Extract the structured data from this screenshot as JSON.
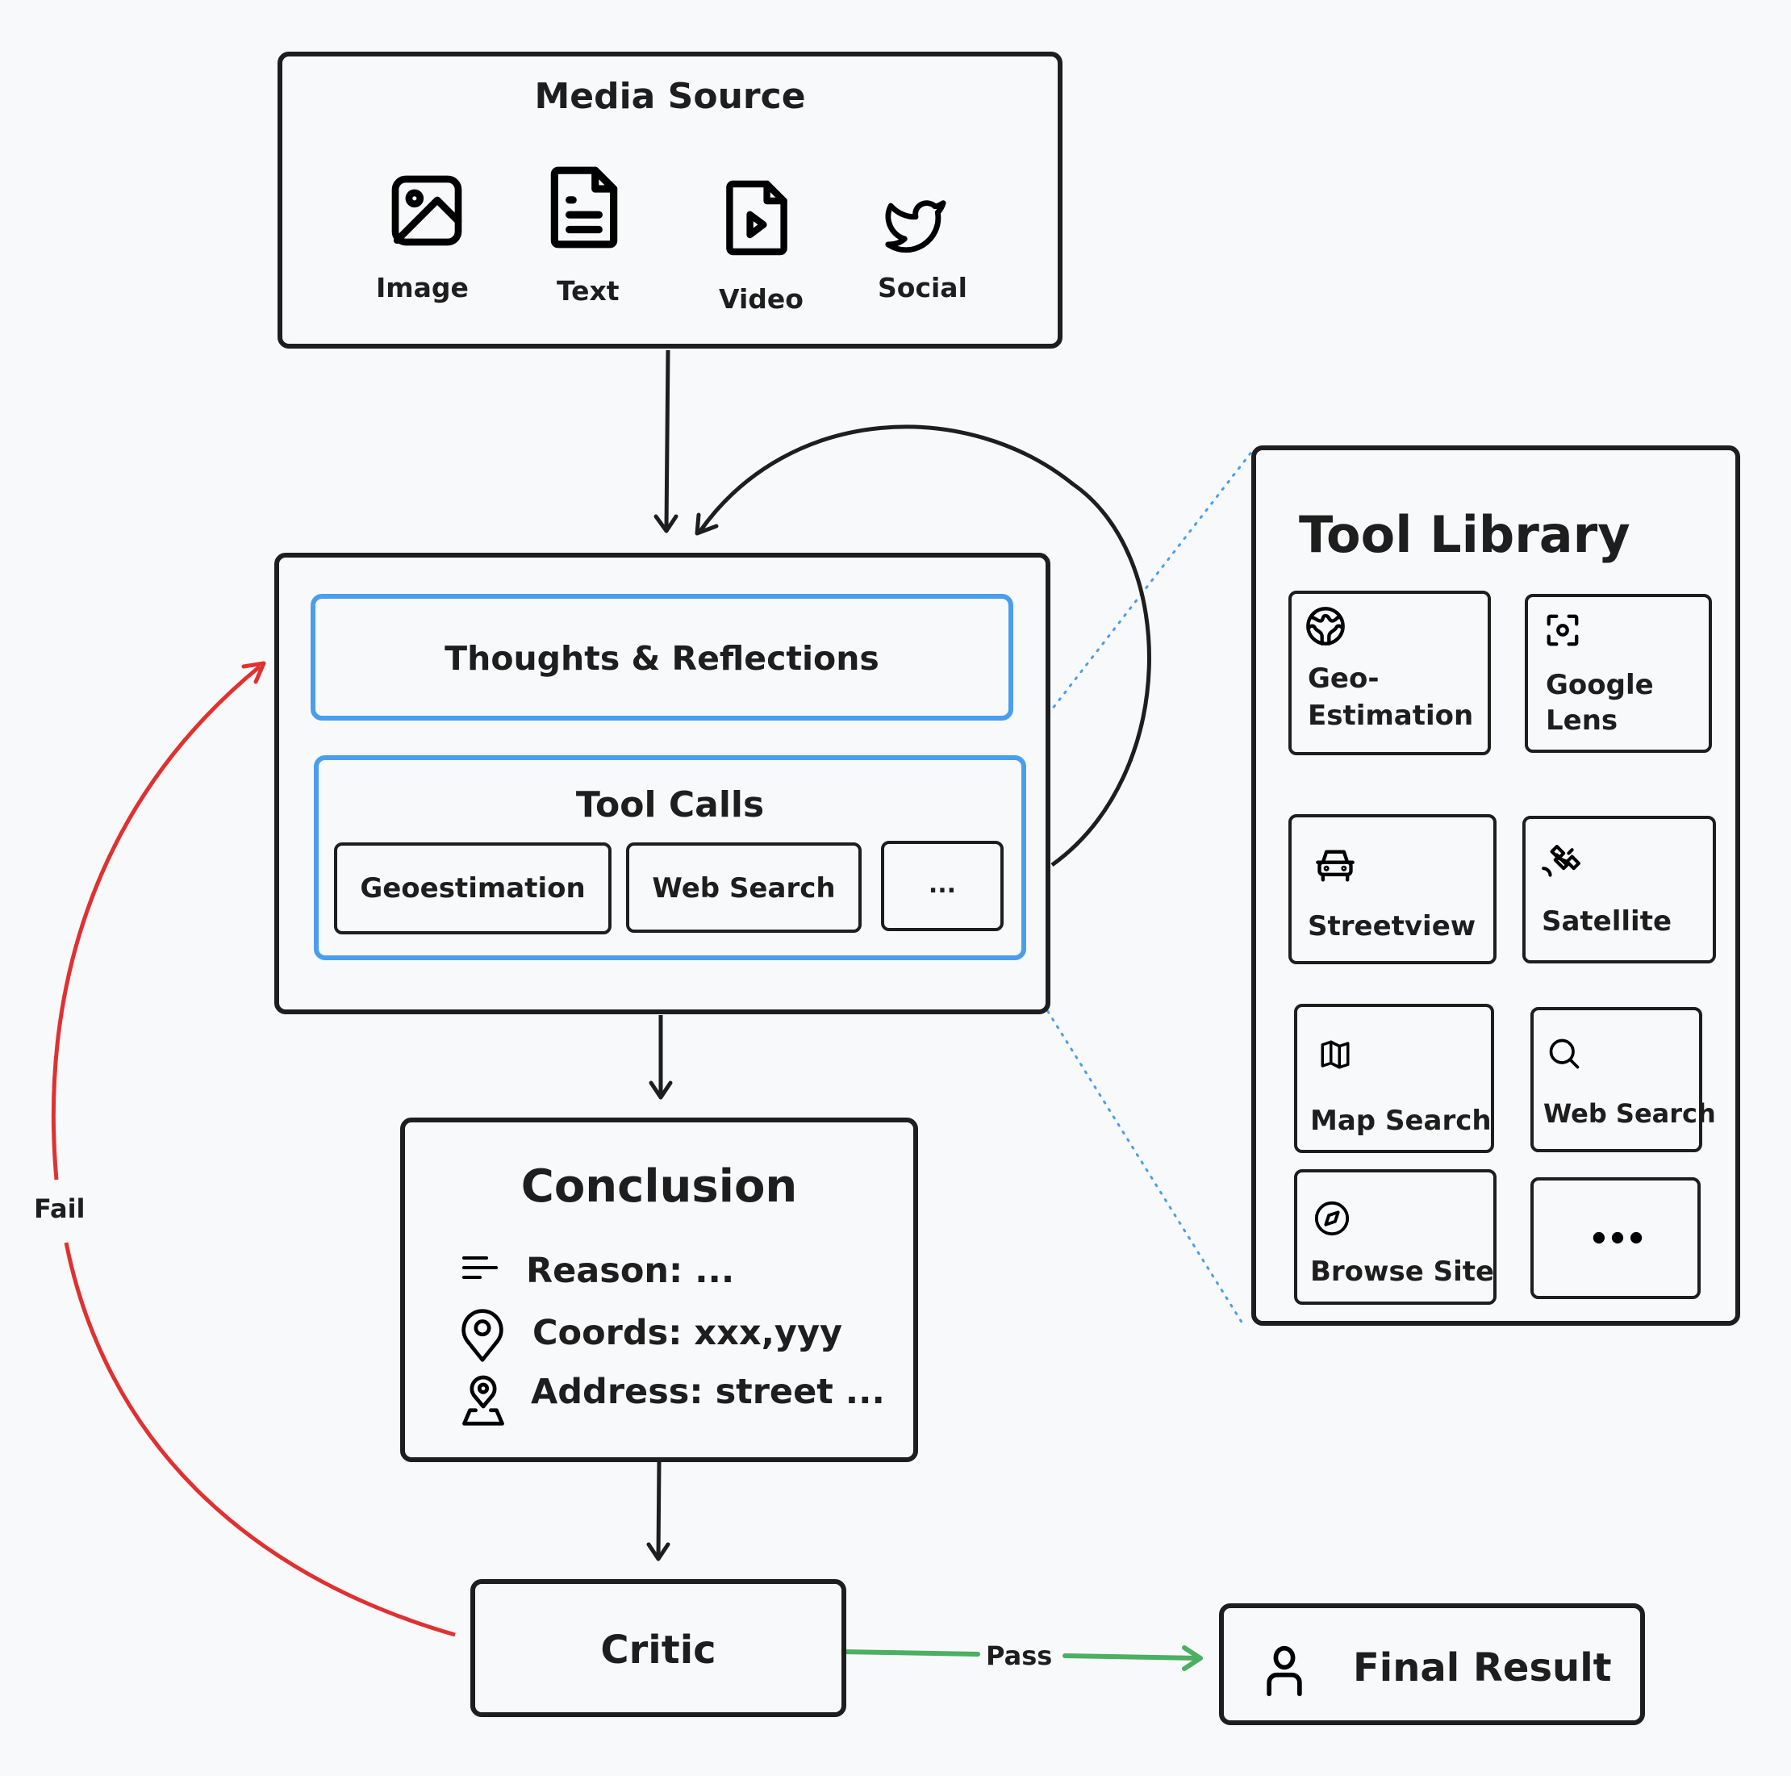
{
  "colors": {
    "background": "#f8f9fb",
    "stroke": "#1e1e1e",
    "accent_blue": "#4a9eed",
    "fail_red": "#e03131",
    "pass_green": "#4caf62"
  },
  "media_source": {
    "title": "Media Source",
    "items": [
      {
        "label": "Image",
        "icon": "image-icon"
      },
      {
        "label": "Text",
        "icon": "document-text-icon"
      },
      {
        "label": "Video",
        "icon": "video-file-icon"
      },
      {
        "label": "Social",
        "icon": "twitter-bird-icon"
      }
    ]
  },
  "agent": {
    "thoughts_label": "Thoughts & Reflections",
    "tool_calls": {
      "title": "Tool Calls",
      "items": [
        "Geoestimation",
        "Web Search",
        "..."
      ]
    }
  },
  "conclusion": {
    "title": "Conclusion",
    "rows": [
      {
        "icon": "text-lines-icon",
        "text": "Reason: ..."
      },
      {
        "icon": "map-pin-icon",
        "text": "Coords: xxx,yyy"
      },
      {
        "icon": "map-location-icon",
        "text": "Address: street ..."
      }
    ]
  },
  "critic": {
    "label": "Critic"
  },
  "edges": {
    "fail_label": "Fail",
    "pass_label": "Pass"
  },
  "final_result": {
    "label": "Final Result",
    "icon": "user-icon"
  },
  "tool_library": {
    "title": "Tool Library",
    "tools": [
      {
        "label_line1": "Geo-",
        "label_line2": "Estimation",
        "icon": "globe-icon"
      },
      {
        "label_line1": "Google",
        "label_line2": "Lens",
        "icon": "focus-scan-icon"
      },
      {
        "label_line1": "Streetview",
        "label_line2": "",
        "icon": "car-icon"
      },
      {
        "label_line1": "Satellite",
        "label_line2": "",
        "icon": "satellite-icon"
      },
      {
        "label_line1": "Map Search",
        "label_line2": "",
        "icon": "map-icon"
      },
      {
        "label_line1": "Web Search",
        "label_line2": "",
        "icon": "search-icon"
      },
      {
        "label_line1": "Browse Site",
        "label_line2": "",
        "icon": "compass-icon"
      },
      {
        "label_line1": "...",
        "label_line2": "",
        "icon": "more-dots-icon"
      }
    ]
  }
}
